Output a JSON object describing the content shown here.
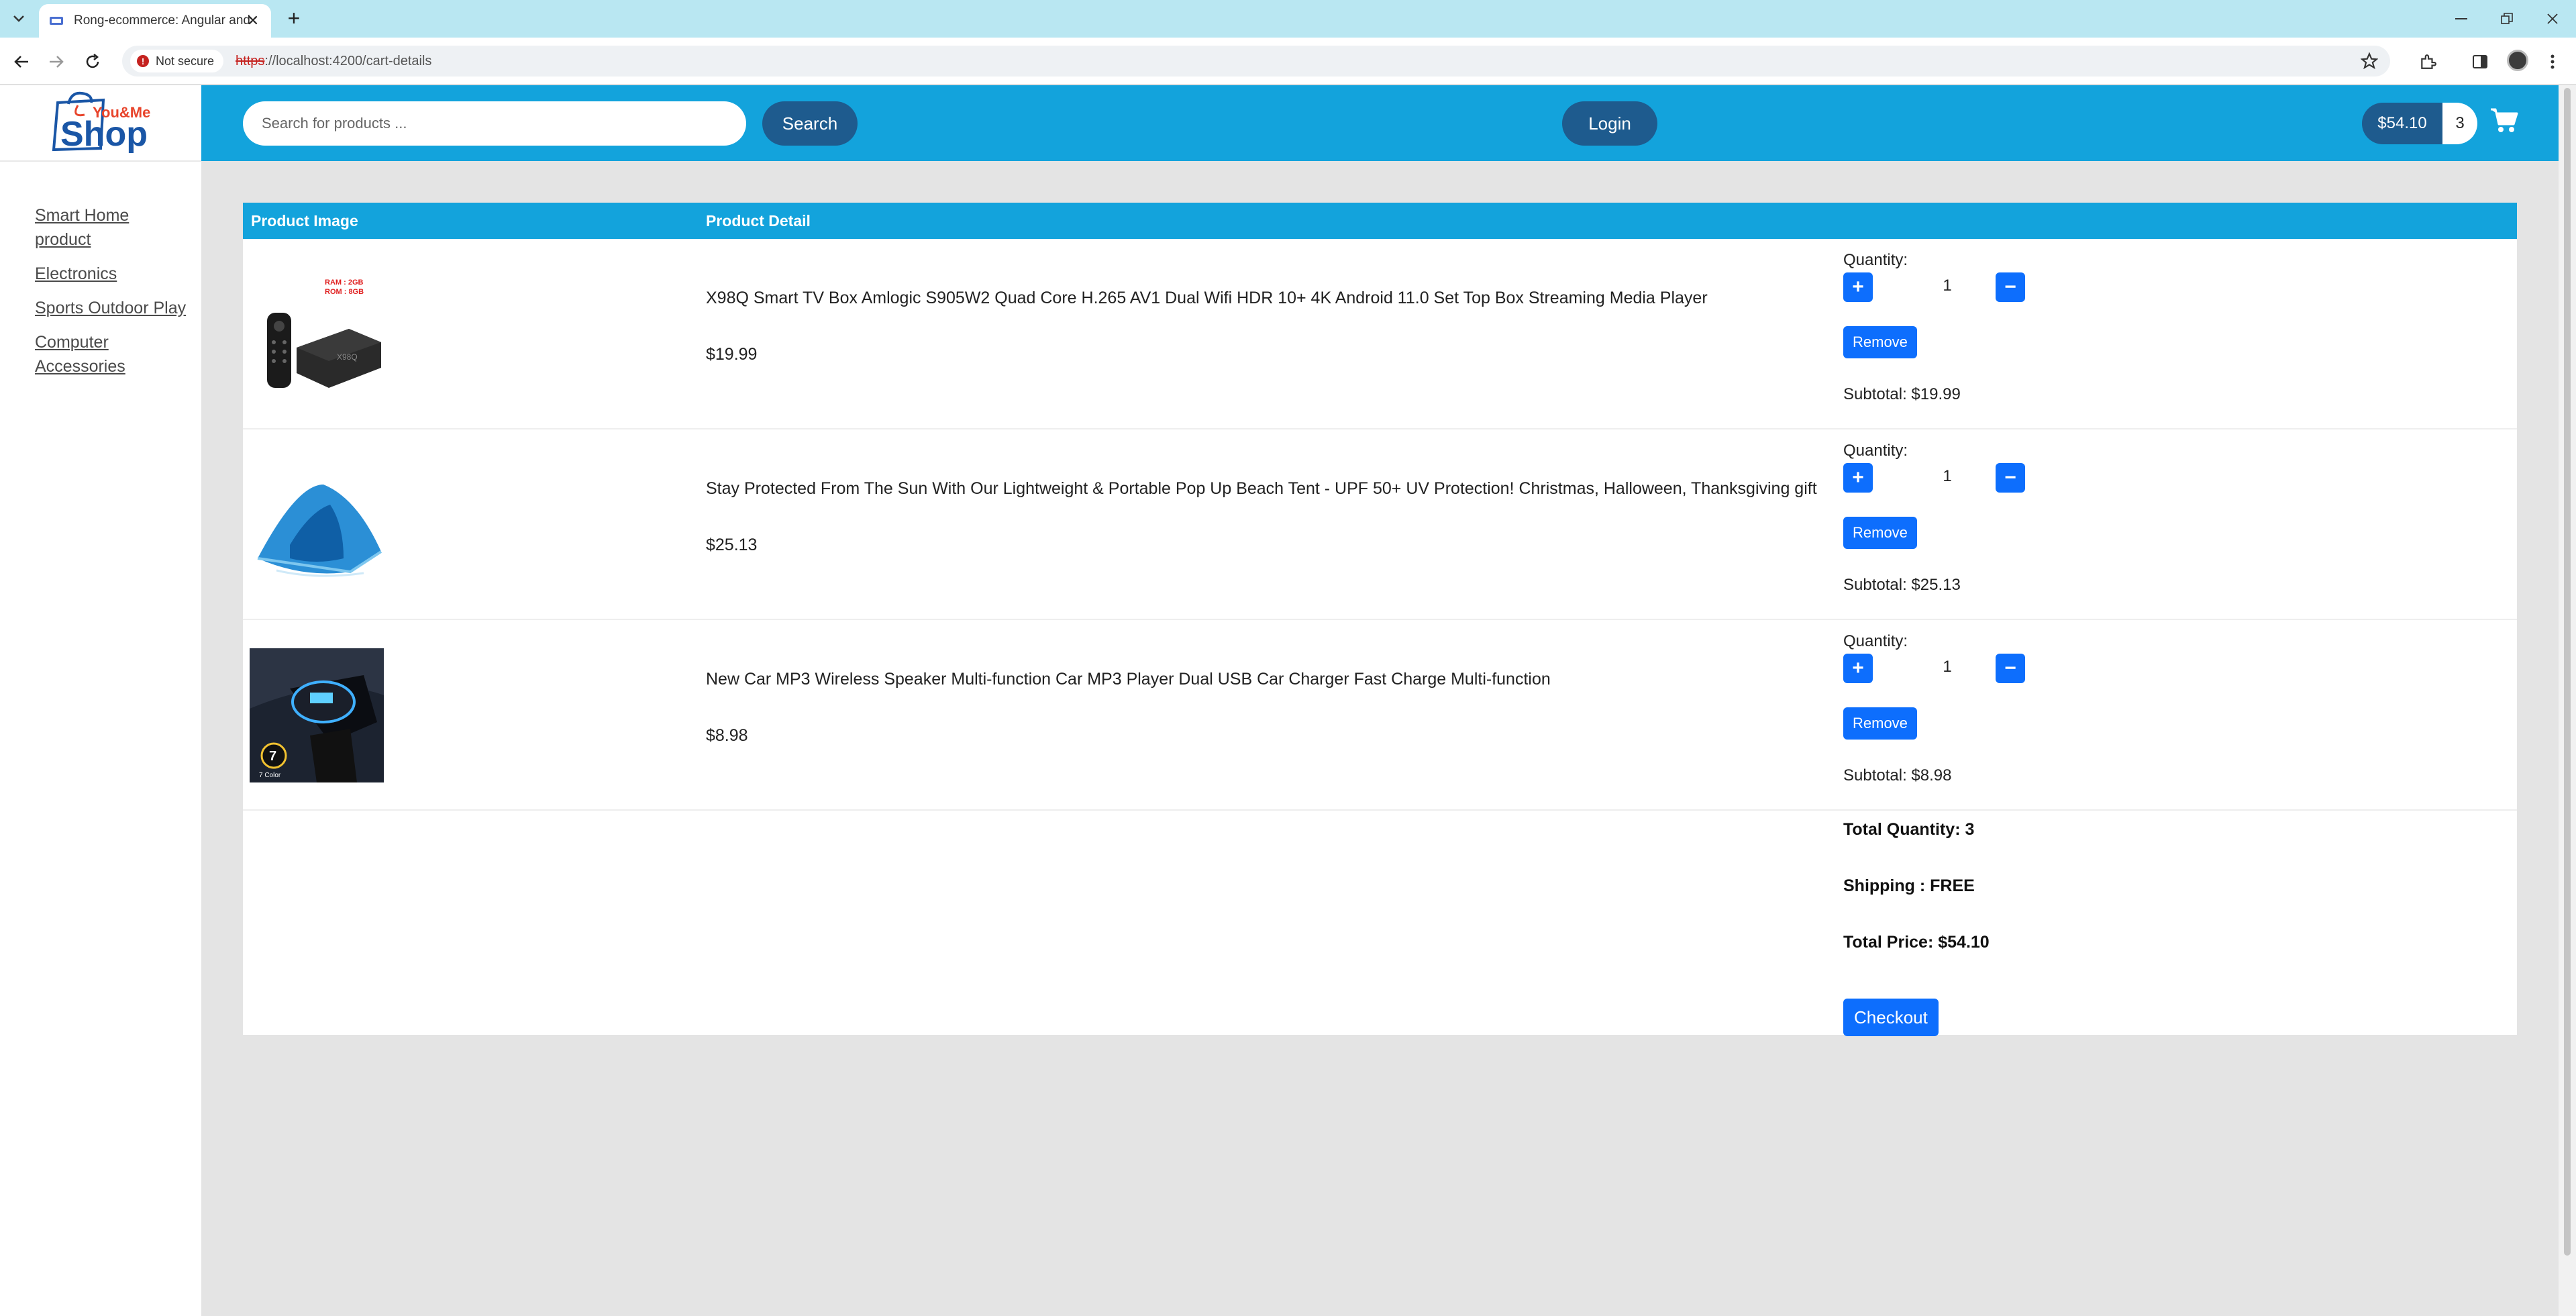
{
  "browser": {
    "tab_title": "Rong-ecommerce: Angular and",
    "security_label": "Not secure",
    "url_scheme": "https",
    "url_rest": "://localhost:4200/cart-details"
  },
  "logo": {
    "small_text": "You&Me",
    "big_text": "Shop"
  },
  "sidebar": {
    "categories": [
      {
        "label": "Smart Home product"
      },
      {
        "label": "Electronics"
      },
      {
        "label": "Sports Outdoor Play"
      },
      {
        "label": "Computer Accessories"
      }
    ]
  },
  "header": {
    "search_placeholder": "Search for products ...",
    "search_label": "Search",
    "login_label": "Login",
    "cart_total": "$54.10",
    "cart_count": "3"
  },
  "table": {
    "col_image": "Product Image",
    "col_detail": "Product Detail",
    "quantity_label": "Quantity:",
    "remove_label": "Remove",
    "items": [
      {
        "name": "X98Q Smart TV Box Amlogic S905W2 Quad Core H.265 AV1 Dual Wifi HDR 10+ 4K Android 11.0 Set Top Box Streaming Media Player",
        "price": "$19.99",
        "quantity": "1",
        "subtotal": "Subtotal: $19.99",
        "image_text_1": "RAM : 2GB",
        "image_text_2": "ROM : 8GB"
      },
      {
        "name": "Stay Protected From The Sun With Our Lightweight & Portable Pop Up Beach Tent - UPF 50+ UV Protection! Christmas, Halloween, Thanksgiving gift",
        "price": "$25.13",
        "quantity": "1",
        "subtotal": "Subtotal: $25.13"
      },
      {
        "name": "New Car MP3 Wireless Speaker Multi-function Car MP3 Player Dual USB Car Charger Fast Charge Multi-function",
        "price": "$8.98",
        "quantity": "1",
        "subtotal": "Subtotal: $8.98",
        "image_text_1": "7",
        "image_text_2": "7 Color"
      }
    ]
  },
  "summary": {
    "total_quantity": "Total Quantity: 3",
    "shipping": "Shipping : FREE",
    "total_price": "Total Price: $54.10",
    "checkout_label": "Checkout"
  },
  "colors": {
    "header_blue": "#13a3dc",
    "dark_button": "#1e5b8e",
    "primary_button": "#0d6efd",
    "tabstrip": "#b9e7f2"
  }
}
